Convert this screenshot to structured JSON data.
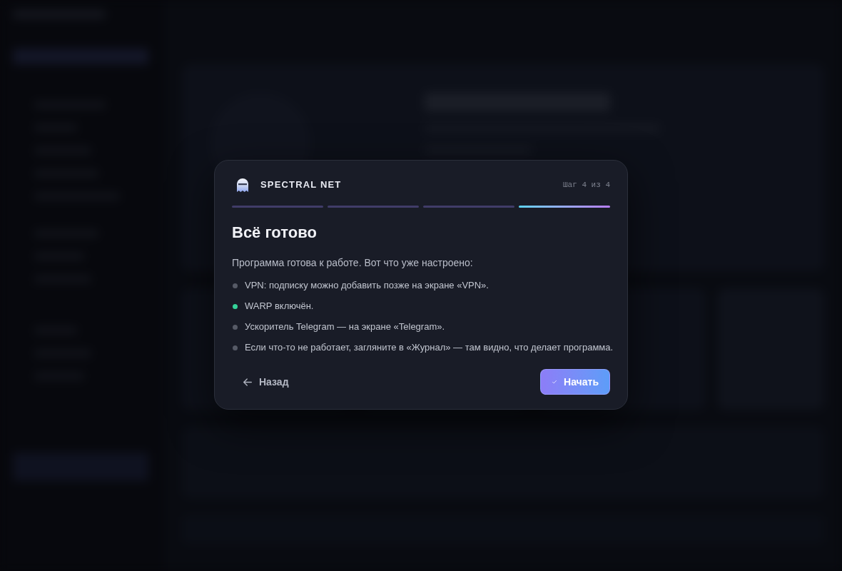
{
  "dialog": {
    "brand": "SPECTRAL NET",
    "step_counter": "Шаг 4 из 4",
    "steps": [
      {
        "current": false
      },
      {
        "current": false
      },
      {
        "current": false
      },
      {
        "current": true
      }
    ],
    "title": "Всё готово",
    "intro": "Программа готова к работе. Вот что уже настроено:",
    "items": [
      {
        "text": "VPN: подписку можно добавить позже на экране «VPN».",
        "color": "#565a66"
      },
      {
        "text": "WARP включён.",
        "color": "#34d399"
      },
      {
        "text": "Ускоритель Telegram — на экране «Telegram».",
        "color": "#565a66"
      },
      {
        "text": "Если что-то не работает, загляните в «Журнал» — там видно, что делает программа.",
        "color": "#565a66"
      }
    ],
    "back_button": {
      "label": "Назад"
    },
    "start_button": {
      "label": "Начать"
    }
  }
}
